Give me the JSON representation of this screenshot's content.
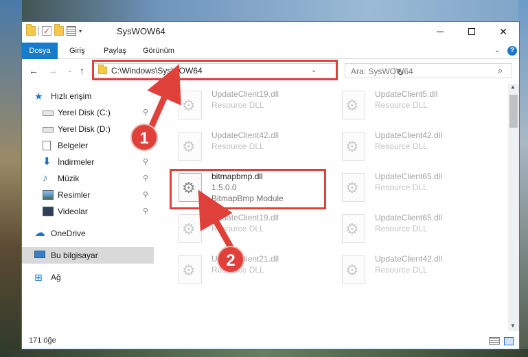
{
  "window": {
    "title": "SysWOW64",
    "min_glyph": "",
    "close_glyph": "✕"
  },
  "ribbon": {
    "tabs": [
      "Dosya",
      "Giriş",
      "Paylaş",
      "Görünüm"
    ],
    "chevron": "⌄",
    "help": "?"
  },
  "navbar": {
    "back": "←",
    "forward": "→",
    "recent": "⌄",
    "up": "↑",
    "address": "C:\\Windows\\SysWOW64",
    "address_drop": "⌄",
    "refresh": "↻",
    "search_placeholder": "Ara: SysWOW64",
    "search_icon": "⌕"
  },
  "sidebar": {
    "quick_access": "Hızlı erişim",
    "items": [
      {
        "label": "Yerel Disk (C:)",
        "pinned": true
      },
      {
        "label": "Yerel Disk (D:)",
        "pinned": true
      },
      {
        "label": "Belgeler",
        "pinned": true
      },
      {
        "label": "İndirmeler",
        "pinned": true
      },
      {
        "label": "Müzik",
        "pinned": true
      },
      {
        "label": "Resimler",
        "pinned": true
      },
      {
        "label": "Videolar",
        "pinned": true
      }
    ],
    "pin_glyph": "📌",
    "onedrive": "OneDrive",
    "this_pc": "Bu bilgisayar",
    "network": "Ağ"
  },
  "files": [
    {
      "name": "UpdateClient19.dll",
      "desc": "Resource DLL",
      "faded": true
    },
    {
      "name": "UpdateClient5.dll",
      "desc": "Resource DLL",
      "faded": true
    },
    {
      "name": "UpdateClient42.dll",
      "desc": "Resource DLL",
      "faded": true
    },
    {
      "name": "UpdateClient42.dll",
      "desc": "Resource DLL",
      "faded": true
    },
    {
      "name": "bitmapbmp.dll",
      "version": "1.5.0.0",
      "desc": "BitmapBmp Module",
      "faded": false
    },
    {
      "name": "UpdateClient65.dll",
      "desc": "Resource DLL",
      "faded": true
    },
    {
      "name": "UpdateClient19.dll",
      "desc": "Resource DLL",
      "faded": true
    },
    {
      "name": "UpdateClient65.dll",
      "desc": "Resource DLL",
      "faded": true
    },
    {
      "name": "UpdateClient21.dll",
      "desc": "Resource DLL",
      "faded": true
    },
    {
      "name": "UpdateClient42.dll",
      "desc": "Resource DLL",
      "faded": true
    }
  ],
  "status": {
    "item_count": "171 öğe"
  },
  "annotations": {
    "step1": "1",
    "step2": "2",
    "color": "#e0403a"
  },
  "colors": {
    "accent": "#1979ca",
    "selection": "#d9d9d9"
  }
}
